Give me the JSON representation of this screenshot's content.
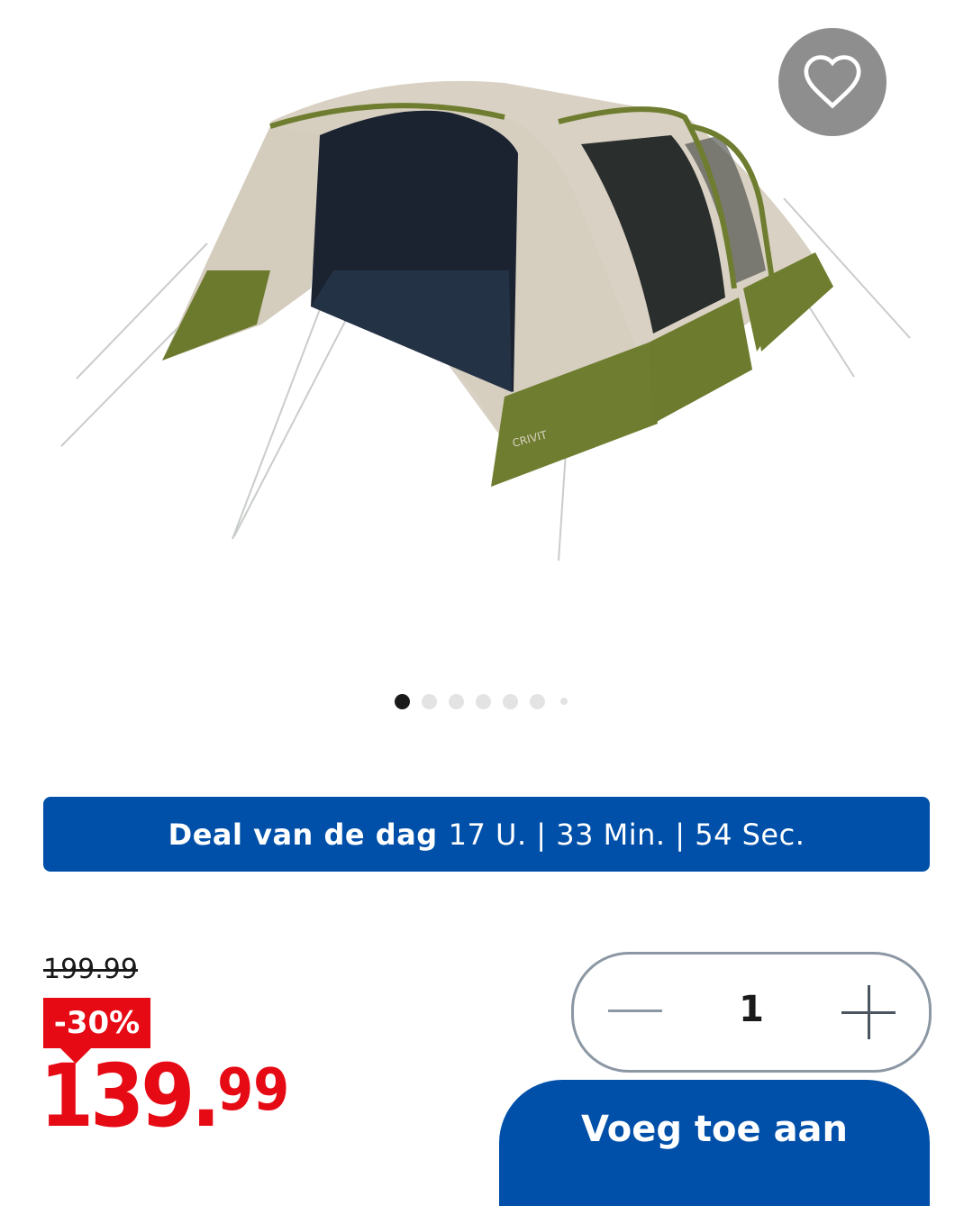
{
  "product": {
    "image_alt": "tent",
    "brand_mark": "CRIVIT"
  },
  "favorite": {
    "icon": "heart-icon"
  },
  "carousel": {
    "total": 7,
    "active_index": 0
  },
  "deal": {
    "label": "Deal van de dag",
    "countdown": "17 U. | 33 Min. | 54 Sec."
  },
  "pricing": {
    "old_price": "199.99",
    "discount": "-30%",
    "price_main": "139.",
    "price_cents": "99"
  },
  "quantity": {
    "value": "1"
  },
  "cta": {
    "label": "Voeg toe aan"
  },
  "colors": {
    "brand_blue": "#0050aa",
    "sale_red": "#e60a14",
    "tent_beige": "#d8d0c2",
    "tent_green": "#6e7d2f"
  }
}
